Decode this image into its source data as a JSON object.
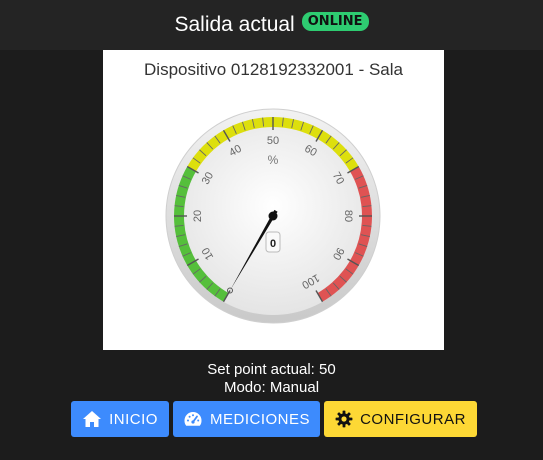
{
  "header": {
    "title": "Salida actual",
    "status_badge": "ONLINE"
  },
  "device": {
    "label": "Dispositivo 0128192332001 - Sala"
  },
  "gauge": {
    "unit": "%",
    "value": 0,
    "value_display": "0",
    "min": 0,
    "max": 100,
    "ticks": [
      "10",
      "20",
      "30",
      "40",
      "50",
      "60",
      "70",
      "80",
      "90",
      "100"
    ],
    "zones": [
      {
        "from": 0,
        "to": 30,
        "color": "#55bf3b"
      },
      {
        "from": 30,
        "to": 70,
        "color": "#dddf0d"
      },
      {
        "from": 70,
        "to": 100,
        "color": "#df5353"
      }
    ]
  },
  "status": {
    "setpoint": "Set point actual: 50",
    "mode": "Modo: Manual"
  },
  "buttons": {
    "inicio": "INICIO",
    "mediciones": "MEDICIONES",
    "configurar": "CONFIGURAR"
  },
  "colors": {
    "primary": "#3d8bfd",
    "warning": "#fdd835",
    "online": "#2ecc71"
  }
}
